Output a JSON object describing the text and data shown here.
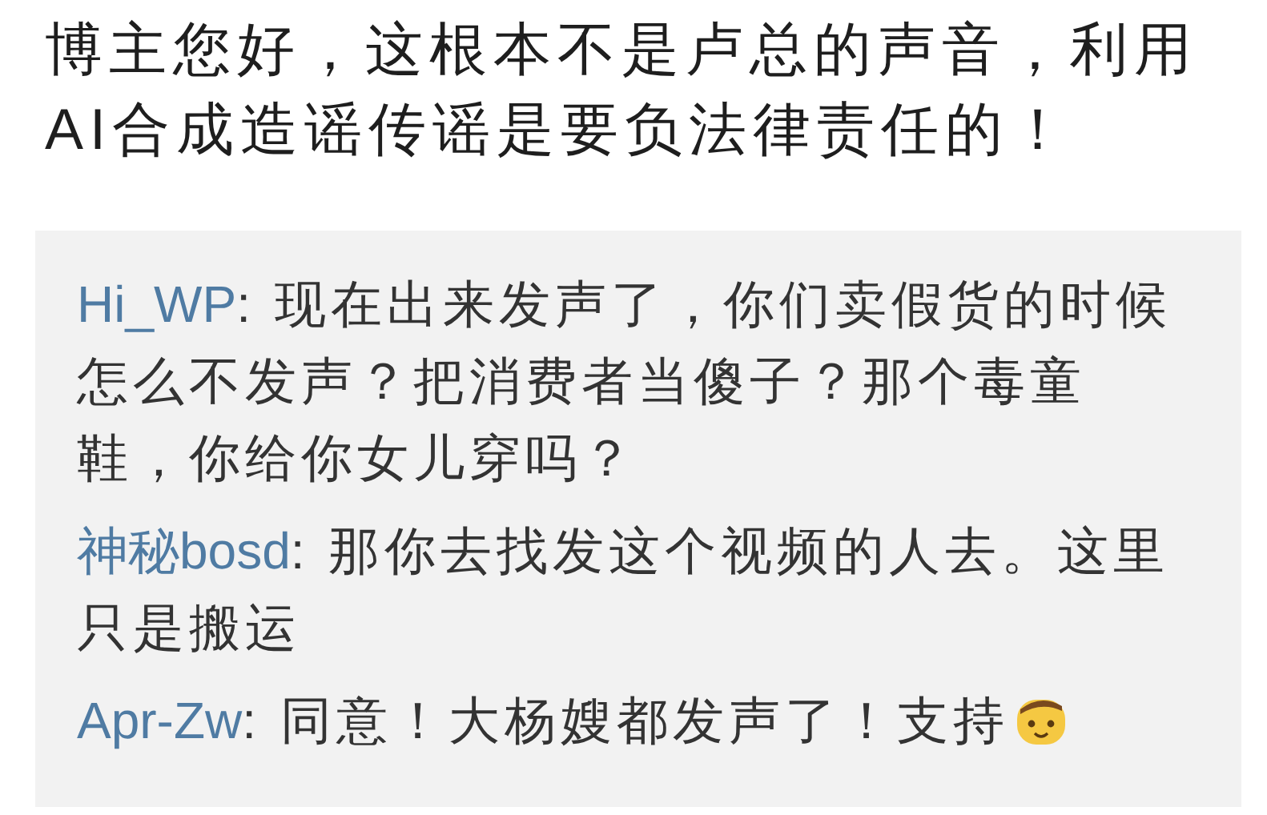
{
  "post": {
    "text": "博主您好，这根本不是卢总的声音，利用AI合成造谣传谣是要负法律责任的！"
  },
  "replies": [
    {
      "user": "Hi_WP",
      "text": ": 现在出来发声了，你们卖假货的时候怎么不发声？把消费者当傻子？那个毒童鞋，你给你女儿穿吗？",
      "emoji": false
    },
    {
      "user": "神秘bosd",
      "text": ": 那你去找发这个视频的人去。这里只是搬运",
      "emoji": false
    },
    {
      "user": "Apr-Zw",
      "text": ": 同意！大杨嫂都发声了！支持",
      "emoji": true
    }
  ]
}
